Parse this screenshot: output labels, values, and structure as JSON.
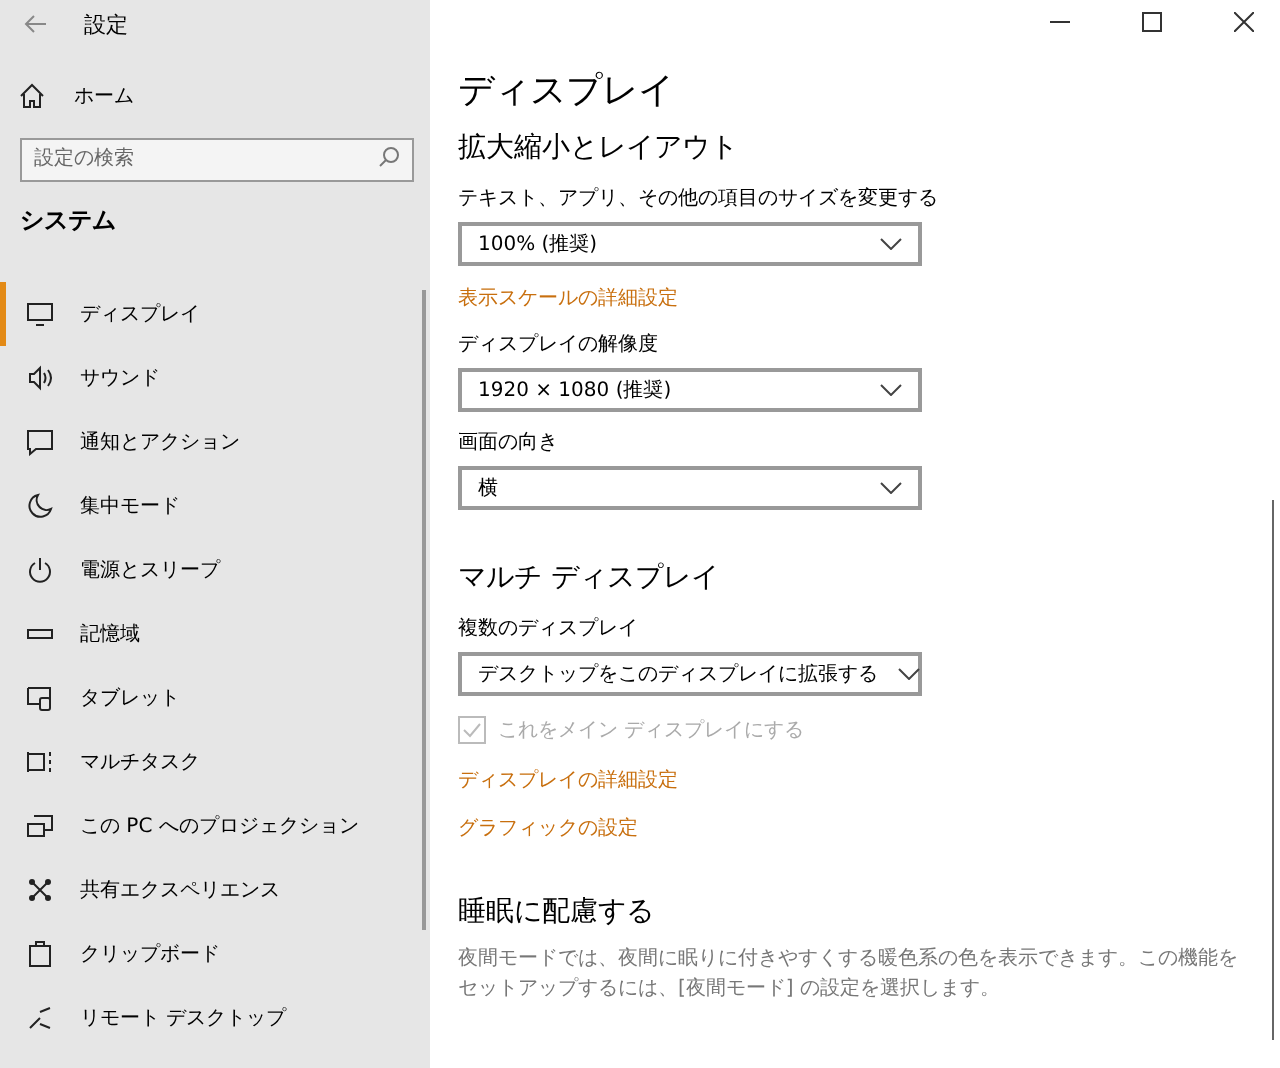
{
  "window": {
    "title": "設定"
  },
  "sidebar": {
    "home": "ホーム",
    "search": {
      "placeholder": "設定の検索"
    },
    "section": "システム",
    "items": [
      {
        "label": "ディスプレイ",
        "selected": true
      },
      {
        "label": "サウンド",
        "selected": false
      },
      {
        "label": "通知とアクション",
        "selected": false
      },
      {
        "label": "集中モード",
        "selected": false
      },
      {
        "label": "電源とスリープ",
        "selected": false
      },
      {
        "label": "記憶域",
        "selected": false
      },
      {
        "label": "タブレット",
        "selected": false
      },
      {
        "label": "マルチタスク",
        "selected": false
      },
      {
        "label": "この PC へのプロジェクション",
        "selected": false
      },
      {
        "label": "共有エクスペリエンス",
        "selected": false
      },
      {
        "label": "クリップボード",
        "selected": false
      },
      {
        "label": "リモート デスクトップ",
        "selected": false
      }
    ]
  },
  "page": {
    "title": "ディスプレイ",
    "content": [
      {
        "kind": "heading",
        "text": "拡大縮小とレイアウト"
      },
      {
        "kind": "label",
        "text": "テキスト、アプリ、その他の項目のサイズを変更する"
      },
      {
        "kind": "dropdown",
        "text": "100% (推奨)"
      },
      {
        "kind": "link",
        "text": "表示スケールの詳細設定"
      },
      {
        "kind": "label",
        "text": "ディスプレイの解像度"
      },
      {
        "kind": "dropdown",
        "text": "1920 × 1080 (推奨)"
      },
      {
        "kind": "label",
        "text": "画面の向き"
      },
      {
        "kind": "dropdown",
        "text": "横"
      },
      {
        "kind": "heading",
        "text": "マルチ ディスプレイ"
      },
      {
        "kind": "label",
        "text": "複数のディスプレイ"
      },
      {
        "kind": "dropdown",
        "text": "デスクトップをこのディスプレイに拡張する"
      },
      {
        "kind": "checkbox",
        "text": "これをメイン ディスプレイにする",
        "checked": true,
        "disabled": true
      },
      {
        "kind": "link",
        "text": "ディスプレイの詳細設定"
      },
      {
        "kind": "link",
        "text": "グラフィックの設定"
      },
      {
        "kind": "heading",
        "text": "睡眠に配慮する"
      },
      {
        "kind": "description",
        "text": "夜間モードでは、夜間に眠りに付きやすくする暖色系の色を表示できます。この機能をセットアップするには、[夜間モード] の設定を選択します。"
      }
    ]
  }
}
